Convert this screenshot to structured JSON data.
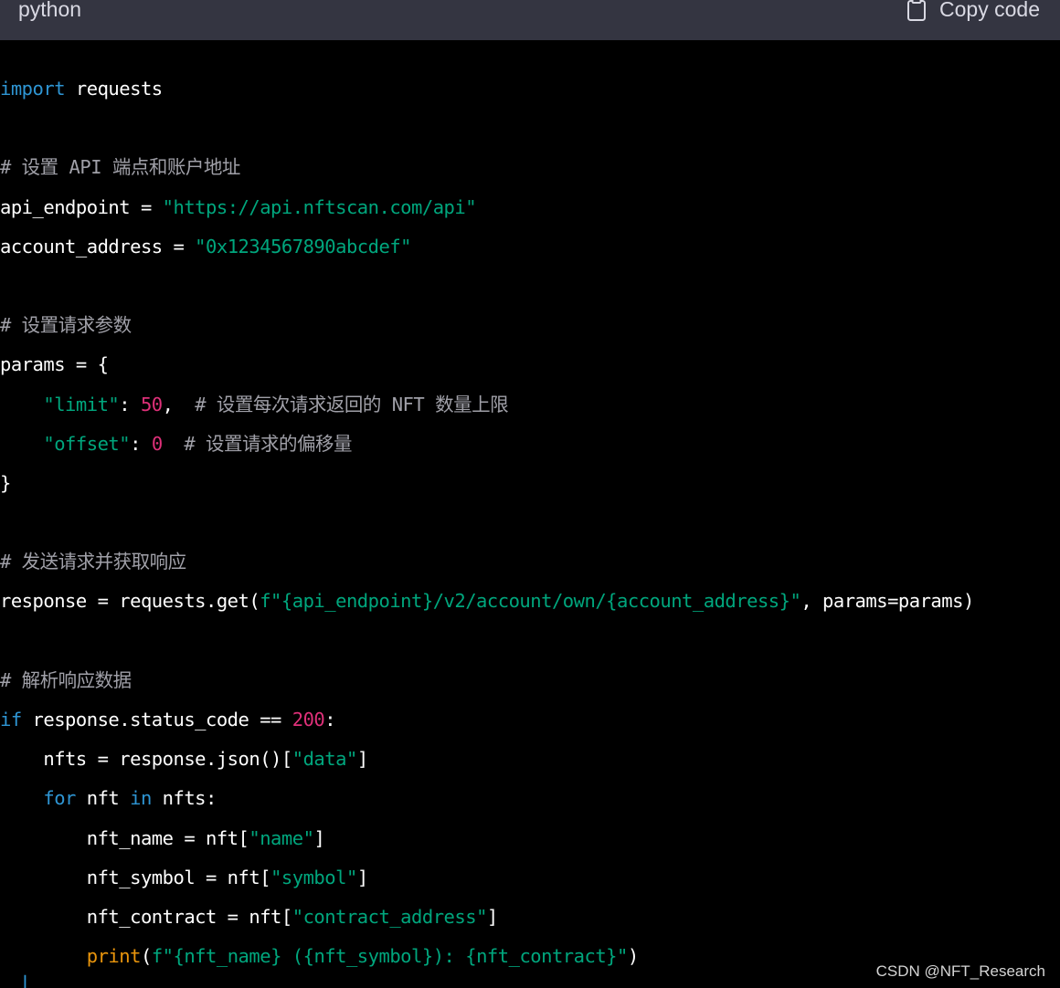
{
  "header": {
    "language": "python",
    "copy_label": "Copy code",
    "copy_icon": "clipboard-icon"
  },
  "colors": {
    "background": "#000000",
    "header_background": "#343541",
    "keyword": "#2e95d3",
    "string": "#00a67d",
    "number": "#df3079",
    "comment": "#a0a0a8",
    "builtin": "#e9950c",
    "text": "#ffffff"
  },
  "code": {
    "lines": [
      [
        {
          "t": "kw",
          "v": "import"
        },
        {
          "t": "plain",
          "v": " requests"
        }
      ],
      [],
      [
        {
          "t": "comment",
          "v": "# 设置 API 端点和账户地址"
        }
      ],
      [
        {
          "t": "plain",
          "v": "api_endpoint = "
        },
        {
          "t": "str",
          "v": "\"https://api.nftscan.com/api\""
        }
      ],
      [
        {
          "t": "plain",
          "v": "account_address = "
        },
        {
          "t": "str",
          "v": "\"0x1234567890abcdef\""
        }
      ],
      [],
      [
        {
          "t": "comment",
          "v": "# 设置请求参数"
        }
      ],
      [
        {
          "t": "plain",
          "v": "params = {"
        }
      ],
      [
        {
          "t": "plain",
          "v": "    "
        },
        {
          "t": "str",
          "v": "\"limit\""
        },
        {
          "t": "plain",
          "v": ": "
        },
        {
          "t": "num",
          "v": "50"
        },
        {
          "t": "plain",
          "v": ",  "
        },
        {
          "t": "comment",
          "v": "# 设置每次请求返回的 NFT 数量上限"
        }
      ],
      [
        {
          "t": "plain",
          "v": "    "
        },
        {
          "t": "str",
          "v": "\"offset\""
        },
        {
          "t": "plain",
          "v": ": "
        },
        {
          "t": "num",
          "v": "0"
        },
        {
          "t": "plain",
          "v": "  "
        },
        {
          "t": "comment",
          "v": "# 设置请求的偏移量"
        }
      ],
      [
        {
          "t": "plain",
          "v": "}"
        }
      ],
      [],
      [
        {
          "t": "comment",
          "v": "# 发送请求并获取响应"
        }
      ],
      [
        {
          "t": "plain",
          "v": "response = requests.get("
        },
        {
          "t": "str",
          "v": "f\"{api_endpoint}/v2/account/own/{account_address}\""
        },
        {
          "t": "plain",
          "v": ", params=params)"
        }
      ],
      [],
      [
        {
          "t": "comment",
          "v": "# 解析响应数据"
        }
      ],
      [
        {
          "t": "kw",
          "v": "if"
        },
        {
          "t": "plain",
          "v": " response.status_code == "
        },
        {
          "t": "num",
          "v": "200"
        },
        {
          "t": "plain",
          "v": ":"
        }
      ],
      [
        {
          "t": "plain",
          "v": "    nfts = response.json()["
        },
        {
          "t": "str",
          "v": "\"data\""
        },
        {
          "t": "plain",
          "v": "]"
        }
      ],
      [
        {
          "t": "plain",
          "v": "    "
        },
        {
          "t": "kw",
          "v": "for"
        },
        {
          "t": "plain",
          "v": " nft "
        },
        {
          "t": "kw",
          "v": "in"
        },
        {
          "t": "plain",
          "v": " nfts:"
        }
      ],
      [
        {
          "t": "plain",
          "v": "        nft_name = nft["
        },
        {
          "t": "str",
          "v": "\"name\""
        },
        {
          "t": "plain",
          "v": "]"
        }
      ],
      [
        {
          "t": "plain",
          "v": "        nft_symbol = nft["
        },
        {
          "t": "str",
          "v": "\"symbol\""
        },
        {
          "t": "plain",
          "v": "]"
        }
      ],
      [
        {
          "t": "plain",
          "v": "        nft_contract = nft["
        },
        {
          "t": "str",
          "v": "\"contract_address\""
        },
        {
          "t": "plain",
          "v": "]"
        }
      ],
      [
        {
          "t": "plain",
          "v": "        "
        },
        {
          "t": "builtin",
          "v": "print"
        },
        {
          "t": "plain",
          "v": "("
        },
        {
          "t": "str",
          "v": "f\"{nft_name} ({nft_symbol}): {nft_contract}\""
        },
        {
          "t": "plain",
          "v": ")"
        }
      ]
    ]
  },
  "watermark": "CSDN @NFT_Research"
}
